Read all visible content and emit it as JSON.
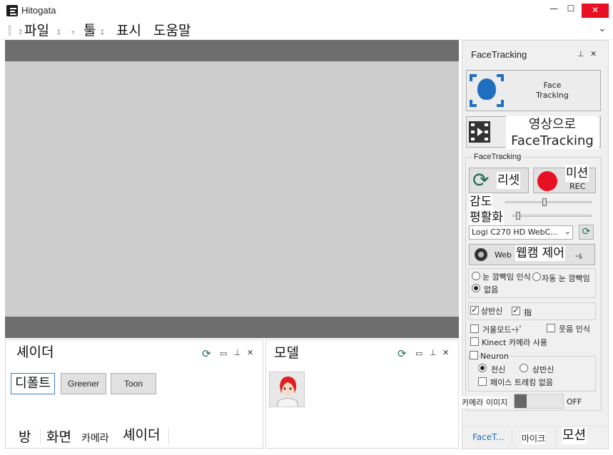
{
  "window": {
    "title": "Hitogata",
    "minimize": "—",
    "maximize": "☐",
    "close": "✕"
  },
  "menu": {
    "items": [
      "파일",
      "툴",
      "표시",
      "도움말"
    ],
    "ghost_chars": [
      "ﾌ",
      "ｴ",
      "ｯ",
      "ｴ"
    ],
    "overflow": "⌄"
  },
  "facetracking_panel": {
    "title": "FaceTracking",
    "face_tracking_button": "Face\nTracking",
    "video_face_tracking_button": "영상으로\nFaceTracking",
    "group_title": "FaceTracking",
    "reset_button": "리셋",
    "motion_label": "미션",
    "rec_label": "REC",
    "sensitivity_label": "감도",
    "smoothing_label": "평활화",
    "camera_select": "Logi C270 HD WebC...",
    "webcam_prefix": "Web",
    "webcam_label": "웹캠 제어",
    "webcam_suffix": "ｰﾙ",
    "eye_blink": "눈 깜빡임 인식",
    "auto_blink": "자동 눈 깜빡임",
    "none_option": "없음",
    "upper_body": "상반신",
    "finger": "指",
    "mirror_mode": "거울모드ｰﾄﾞ",
    "smile_detect": "웃음 인식",
    "kinect": "Kinect 카메라 사용",
    "neuron": "Neuron",
    "full_body": "전신",
    "upper_body_radio": "상반신",
    "no_face_tracking": "페이스 트레킹 없음",
    "camera_image_label": "카메라 이미지",
    "off_label": "OFF",
    "slider_sensitivity": 0.45,
    "slider_smoothing": 0.05
  },
  "shader_panel": {
    "title": "셰이더",
    "buttons": [
      "디폴트",
      "Greener",
      "Toon"
    ],
    "tabs": [
      "방",
      "화면",
      "카메라",
      "셰이더"
    ]
  },
  "model_panel": {
    "title": "모델"
  },
  "right_tabs": [
    "FaceT...",
    "마이크",
    "모션"
  ],
  "colors": {
    "accent_blue": "#1f6fc0",
    "rec_red": "#e81123",
    "reset_green": "#1e6e52",
    "viewport_gray": "#cdcdcd",
    "viewport_bar": "#6e6e6e"
  }
}
